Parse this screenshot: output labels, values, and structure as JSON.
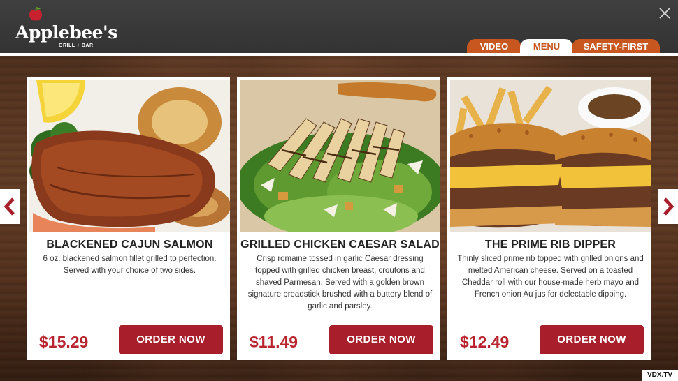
{
  "brand": {
    "name": "Applebee's",
    "tagline": "GRILL + BAR"
  },
  "tabs": [
    {
      "label": "VIDEO",
      "active": false
    },
    {
      "label": "MENU",
      "active": true
    },
    {
      "label": "SAFETY-FIRST",
      "active": false
    }
  ],
  "icons": {
    "close": "close-icon",
    "prev": "chevron-left-icon",
    "next": "chevron-right-icon",
    "logo": "apple-icon"
  },
  "colors": {
    "header": "#3a3a3a",
    "tab_orange": "#c8561f",
    "brand_red": "#a81f2b",
    "price_red": "#b8252f"
  },
  "menu_items": [
    {
      "title": "BLACKENED CAJUN SALMON",
      "description": "6 oz. blackened salmon fillet grilled to perfection. Served with your choice of two sides.",
      "price": "$15.29",
      "button_label": "ORDER NOW",
      "photo": "salmon-photo"
    },
    {
      "title": "GRILLED CHICKEN CAESAR SALAD",
      "description": "Crisp romaine tossed in garlic Caesar dressing topped with grilled chicken breast, croutons and shaved Parmesan. Served with a golden brown signature breadstick brushed with a buttery blend of garlic and parsley.",
      "price": "$11.49",
      "button_label": "ORDER NOW",
      "photo": "caesar-salad-photo"
    },
    {
      "title": "THE PRIME RIB DIPPER",
      "description": "Thinly sliced prime rib topped with grilled onions and melted American cheese. Served on a toasted Cheddar roll with our house-made herb mayo and French onion Au jus for delectable dipping.",
      "price": "$12.49",
      "button_label": "ORDER NOW",
      "photo": "prime-rib-dipper-photo"
    }
  ],
  "watermark": "VDX.TV"
}
